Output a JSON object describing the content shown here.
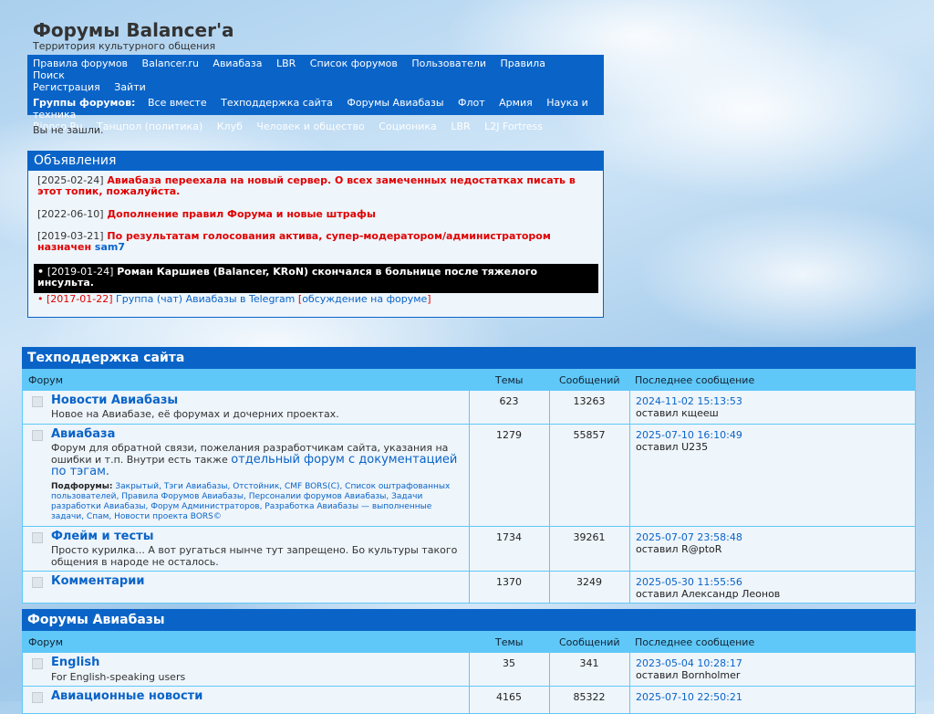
{
  "site": {
    "title": "Форумы Balancer'a",
    "subtitle": "Территория культурного общения"
  },
  "nav": {
    "links": [
      "Правила форумов",
      "Balancer.ru",
      "Авиабаза",
      "LBR",
      "Список форумов",
      "Пользователи",
      "Правила",
      "Поиск",
      "Регистрация",
      "Зайти"
    ],
    "groups_label": "Группы форумов:",
    "groups": [
      "Все вместе",
      "Техподдержка сайта",
      "Форумы Авиабазы",
      "Флот",
      "Армия",
      "Наука и техника",
      "Bionco.Ru",
      "Танцпол (политика)",
      "Клуб",
      "Человек и общество",
      "Соционика",
      "LBR",
      "L2J Fortress"
    ]
  },
  "status": {
    "not_logged": "Вы не зашли."
  },
  "announcements": {
    "title": "Объявления",
    "items": [
      {
        "date": "[2025-02-24]",
        "text": "Авиабаза переехала на новый сервер. О всех замеченных недостатках писать в этот топик, пожалуйста."
      },
      {
        "date": "[2022-06-10]",
        "text": "Дополнение правил Форума и новые штрафы"
      },
      {
        "date": "[2019-03-21]",
        "text": "По результатам голосования актива, супер-модератором/администратором назначен",
        "user": "sam7"
      }
    ],
    "black": {
      "bullet": "•",
      "date": "[2019-01-24]",
      "text": "Роман Каршиев (Balancer, KRoN) скончался в больнице после тяжелого инсульта."
    },
    "last": {
      "bullet": "•",
      "date": "[2017-01-22]",
      "link": "Группа (чат) Авиабазы в Telegram",
      "open": "[",
      "discuss": "обсуждение на форуме",
      "close": "]"
    }
  },
  "columns": {
    "forum": "Форум",
    "topics": "Темы",
    "posts": "Сообщений",
    "last": "Последнее сообщение"
  },
  "sections": [
    {
      "title": "Техподдержка сайта",
      "forums": [
        {
          "name": "Новости Авиабазы",
          "desc": "Новое на Авиабазе, её форумах и дочерних проектах.",
          "topics": "623",
          "posts": "13263",
          "last_date": "2024-11-02 15:13:53",
          "last_by": "оставил кщееш"
        },
        {
          "name": "Авиабаза",
          "desc": "Форум для обратной связи, пожелания разработчикам сайта, указания на ошибки и т.п. Внутри есть также",
          "desc_link": "отдельный форум с документацией по тэгам.",
          "subs_label": "Подфорумы:",
          "subs": "Закрытый, Тэги Авиабазы, Отстойник, CMF BORS(C), Список оштрафованных пользователей, Правила Форумов Авиабазы, Персоналии форумов Авиабазы, Задачи разработки Авиабазы, Форум Администраторов, Разработка Авиабазы — выполненные задачи, Спам, Новости проекта BORS©",
          "topics": "1279",
          "posts": "55857",
          "last_date": "2025-07-10 16:10:49",
          "last_by": "оставил U235"
        },
        {
          "name": "Флейм и тесты",
          "desc": "Просто курилка... А вот ругаться нынче тут запрещено. Бо культуры такого общения в народе не осталось.",
          "topics": "1734",
          "posts": "39261",
          "last_date": "2025-07-07 23:58:48",
          "last_by": "оставил R@ptoR"
        },
        {
          "name": "Комментарии",
          "desc": "",
          "topics": "1370",
          "posts": "3249",
          "last_date": "2025-05-30 11:55:56",
          "last_by": "оставил Александр Леонов"
        }
      ]
    },
    {
      "title": "Форумы Авиабазы",
      "forums": [
        {
          "name": "English",
          "desc": "For English-speaking users",
          "topics": "35",
          "posts": "341",
          "last_date": "2023-05-04 10:28:17",
          "last_by": "оставил Bornholmer"
        },
        {
          "name": "Авиационные новости",
          "desc": "",
          "topics": "4165",
          "posts": "85322",
          "last_date": "2025-07-10 22:50:21",
          "last_by": ""
        }
      ]
    }
  ]
}
